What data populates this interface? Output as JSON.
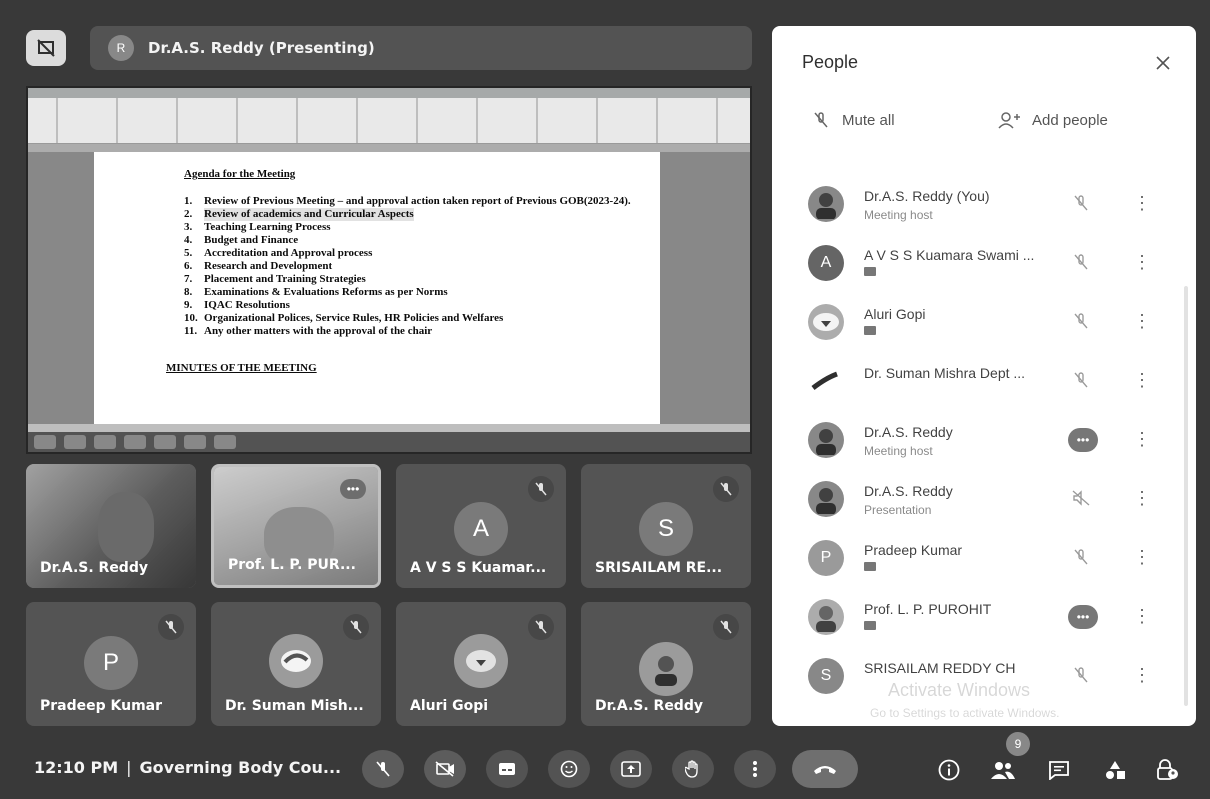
{
  "presenter": {
    "name": "Dr.A.S. Reddy (Presenting)",
    "initial": "R"
  },
  "screen_doc": {
    "agenda_title": "Agenda for the Meeting",
    "items": [
      {
        "n": "1.",
        "t": "Review of Previous Meeting – and approval action taken report of Previous GOB(2023-24)."
      },
      {
        "n": "2.",
        "t": "Review of academics and Curricular Aspects"
      },
      {
        "n": "3.",
        "t": "Teaching Learning Process"
      },
      {
        "n": "4.",
        "t": "Budget and Finance"
      },
      {
        "n": "5.",
        "t": "Accreditation and Approval process"
      },
      {
        "n": "6.",
        "t": "Research and Development"
      },
      {
        "n": "7.",
        "t": "Placement and Training Strategies"
      },
      {
        "n": "8.",
        "t": "Examinations & Evaluations Reforms as per Norms"
      },
      {
        "n": "9.",
        "t": "IQAC Resolutions"
      },
      {
        "n": "10.",
        "t": "Organizational Polices, Service Rules, HR Policies and Welfares"
      },
      {
        "n": "11.",
        "t": "Any other matters with the approval of the chair"
      }
    ],
    "minutes_title": "MINUTES OF THE MEETING"
  },
  "tiles": [
    {
      "label": "Dr.A.S. Reddy",
      "kind": "video"
    },
    {
      "label": "Prof. L. P. PUR...",
      "kind": "video2"
    },
    {
      "label": "A V S S Kuamar...",
      "letter": "A"
    },
    {
      "label": "SRISAILAM RE...",
      "letter": "S"
    },
    {
      "label": "Pradeep Kumar",
      "letter": "P"
    },
    {
      "label": "Dr. Suman Mish...",
      "kind": "photo"
    },
    {
      "label": "Aluri Gopi",
      "kind": "photo"
    },
    {
      "label": "Dr.A.S. Reddy",
      "kind": "photo"
    }
  ],
  "bottom": {
    "time": "12:10 PM",
    "separator": "|",
    "meeting_name": "Governing Body Cou...",
    "people_count": "9"
  },
  "panel": {
    "title": "People",
    "mute_all": "Mute all",
    "add_people": "Add people",
    "people": [
      {
        "name": "Dr.A.S. Reddy (You)",
        "sub": "Meeting host",
        "avatar": "photo"
      },
      {
        "name": "A V S S Kuamara Swami ...",
        "sub": "",
        "avatar": "A"
      },
      {
        "name": "Aluri Gopi",
        "sub": "",
        "avatar": "photo"
      },
      {
        "name": "Dr. Suman Mishra Dept ...",
        "sub": "",
        "avatar": "photo"
      },
      {
        "name": "Dr.A.S. Reddy",
        "sub": "Meeting host",
        "avatar": "photo"
      },
      {
        "name": "Dr.A.S. Reddy",
        "sub": "Presentation",
        "avatar": "photo"
      },
      {
        "name": "Pradeep Kumar",
        "sub": "",
        "avatar": "P"
      },
      {
        "name": "Prof. L. P. PUROHIT",
        "sub": "",
        "avatar": "photo"
      },
      {
        "name": "SRISAILAM REDDY CH",
        "sub": "",
        "avatar": "S"
      }
    ]
  },
  "watermark": {
    "line1": "Activate Windows",
    "line2": "Go to Settings to activate Windows."
  }
}
